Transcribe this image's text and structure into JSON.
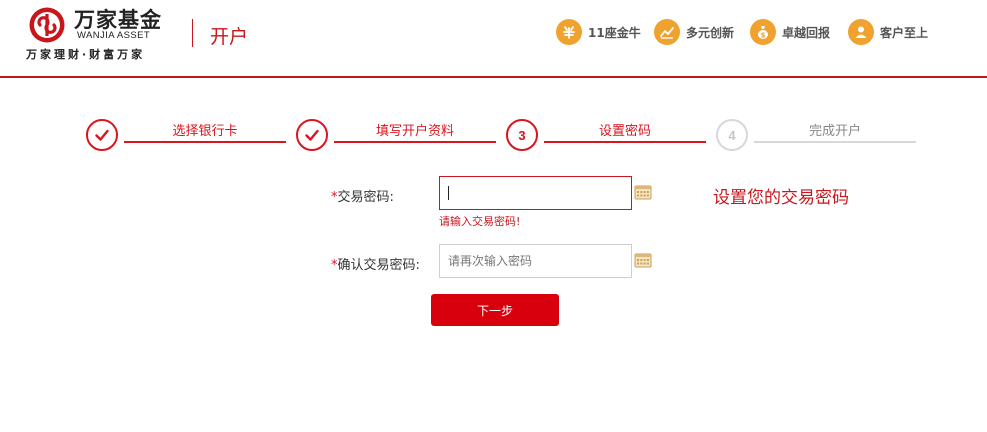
{
  "header": {
    "brand_name": "万家基金",
    "brand_en": "WANJIA  ASSET",
    "slogan": "万家理财·财富万家",
    "page_title": "开户",
    "features": [
      {
        "label": "11座金牛",
        "icon": "bull-icon"
      },
      {
        "label": "多元创新",
        "icon": "chart-trend-icon"
      },
      {
        "label": "卓越回报",
        "icon": "money-bag-icon"
      },
      {
        "label": "客户至上",
        "icon": "user-icon"
      }
    ]
  },
  "steps": [
    {
      "label": "选择银行卡",
      "status": "done"
    },
    {
      "label": "填写开户资料",
      "status": "done"
    },
    {
      "label": "设置密码",
      "number": "3",
      "status": "current"
    },
    {
      "label": "完成开户",
      "number": "4",
      "status": "pending"
    }
  ],
  "form": {
    "password": {
      "label": "交易密码:",
      "required_mark": "*",
      "value": "",
      "error": "请输入交易密码!"
    },
    "confirm": {
      "label": "确认交易密码:",
      "required_mark": "*",
      "value": "",
      "placeholder": "请再次输入密码"
    },
    "hint": "设置您的交易密码",
    "next_label": "下一步"
  },
  "colors": {
    "brand_red": "#c8161d",
    "button_red": "#d9000d",
    "feature_orange": "#f0a22e",
    "inactive_gray": "#d8d8d8"
  }
}
